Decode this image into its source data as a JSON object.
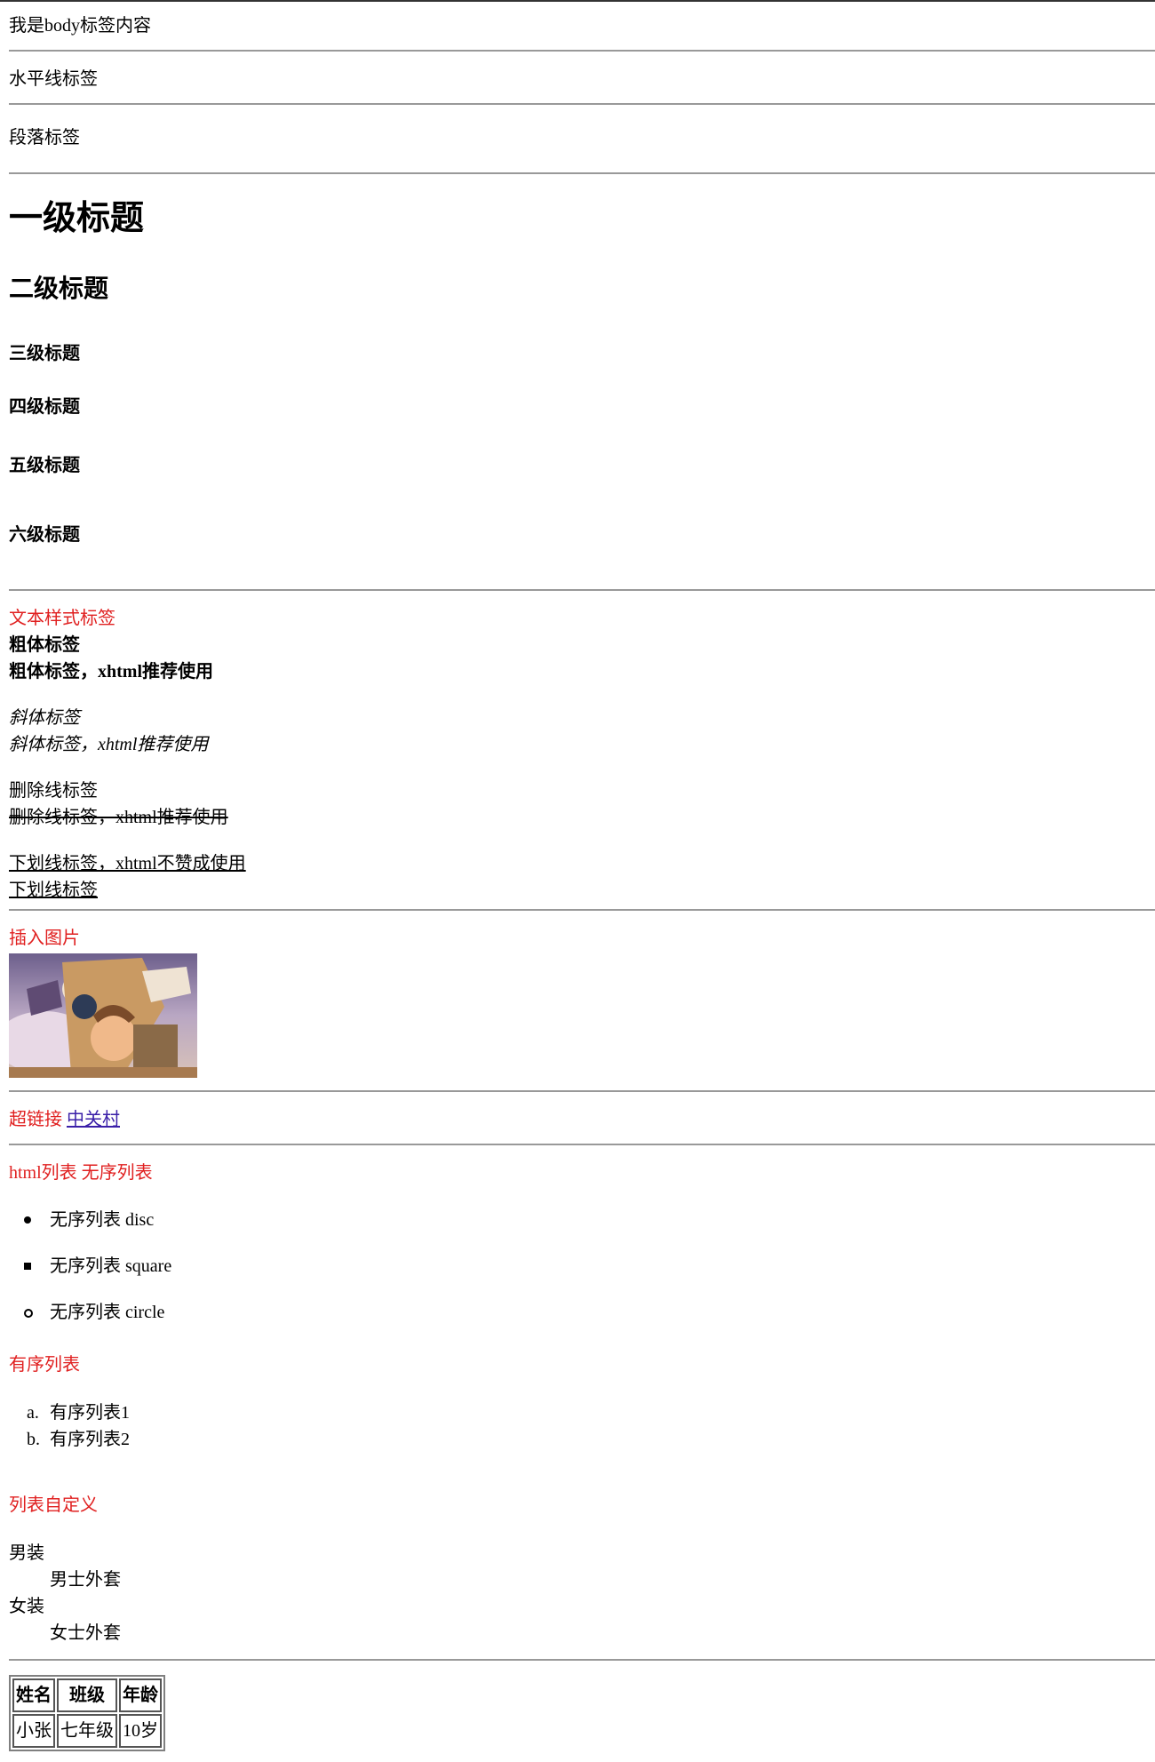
{
  "body_text": "我是body标签内容",
  "hr_label": "水平线标签",
  "p_label": "段落标签",
  "headings": {
    "h1": "一级标题",
    "h2": "二级标题",
    "h3": "三级标题",
    "h4": "四级标题",
    "h5": "五级标题",
    "h6": "六级标题"
  },
  "text_styles": {
    "section_title": "文本样式标签",
    "bold_1": "粗体标签",
    "bold_2_prefix": "粗体标签，",
    "bold_2_tag": "xhtml",
    "bold_2_suffix": "推荐使用",
    "italic_1": "斜体标签",
    "italic_2": "斜体标签，xhtml推荐使用",
    "strike_1": "删除线标签",
    "strike_2": "删除线标签，xhtml推荐使用",
    "underline_1": "下划线标签，xhtml不赞成使用",
    "underline_2": "下划线标签"
  },
  "image_section": {
    "title": "插入图片"
  },
  "link_section": {
    "title": "超链接",
    "link_text": "中关村"
  },
  "lists": {
    "unordered_title": "html列表 无序列表",
    "unordered_items": [
      {
        "text": "无序列表 disc",
        "marker": "disc"
      },
      {
        "text": "无序列表 square",
        "marker": "square"
      },
      {
        "text": "无序列表 circle",
        "marker": "circle"
      }
    ],
    "ordered_title": "有序列表",
    "ordered_items": [
      {
        "marker": "a.",
        "text": "有序列表1"
      },
      {
        "marker": "b.",
        "text": "有序列表2"
      }
    ],
    "definition_title": "列表自定义",
    "definition_items": [
      {
        "term": "男装",
        "desc": "男士外套"
      },
      {
        "term": "女装",
        "desc": "女士外套"
      }
    ]
  },
  "table": {
    "headers": [
      "姓名",
      "班级",
      "年龄"
    ],
    "rows": [
      [
        "小张",
        "七年级",
        "10岁"
      ]
    ]
  },
  "colors": {
    "section_red": "#e02020",
    "link": "#3a1fa8",
    "rule": "#999999"
  }
}
